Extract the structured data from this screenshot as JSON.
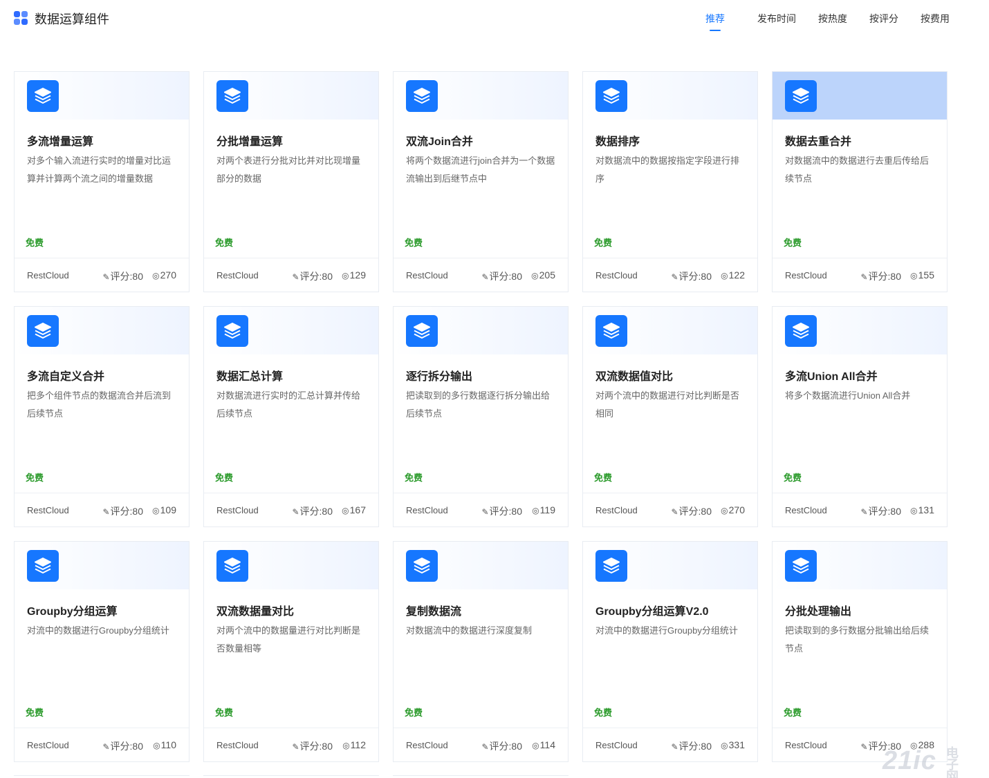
{
  "header": {
    "title": "数据运算组件",
    "tabs": [
      {
        "label": "推荐",
        "active": true
      },
      {
        "label": "发布时间",
        "active": false
      },
      {
        "label": "按热度",
        "active": false
      },
      {
        "label": "按评分",
        "active": false
      },
      {
        "label": "按费用",
        "active": false
      }
    ]
  },
  "colors": {
    "accent": "#1677ff",
    "free": "#2a9a2a"
  },
  "cards": [
    {
      "title": "多流增量运算",
      "desc": "对多个输入流进行实时的增量对比运算并计算两个流之间的增量数据",
      "price": "免费",
      "vendor": "RestCloud",
      "rating": "评分:80",
      "views": "270",
      "icon": "layers-icon",
      "highlighted": false
    },
    {
      "title": "分批增量运算",
      "desc": "对两个表进行分批对比并对比现增量部分的数据",
      "price": "免费",
      "vendor": "RestCloud",
      "rating": "评分:80",
      "views": "129",
      "icon": "layers-icon",
      "highlighted": false
    },
    {
      "title": "双流Join合并",
      "desc": "将两个数据流进行join合并为一个数据流输出到后继节点中",
      "price": "免费",
      "vendor": "RestCloud",
      "rating": "评分:80",
      "views": "205",
      "icon": "layers-icon",
      "highlighted": false
    },
    {
      "title": "数据排序",
      "desc": "对数据流中的数据按指定字段进行排序",
      "price": "免费",
      "vendor": "RestCloud",
      "rating": "评分:80",
      "views": "122",
      "icon": "layers-icon",
      "highlighted": false
    },
    {
      "title": "数据去重合并",
      "desc": "对数据流中的数据进行去重后传给后续节点",
      "price": "免费",
      "vendor": "RestCloud",
      "rating": "评分:80",
      "views": "155",
      "icon": "layers-icon",
      "highlighted": true
    },
    {
      "title": "多流自定义合并",
      "desc": "把多个组件节点的数据流合并后流到后续节点",
      "price": "免费",
      "vendor": "RestCloud",
      "rating": "评分:80",
      "views": "109",
      "icon": "layers-icon",
      "highlighted": false
    },
    {
      "title": "数据汇总计算",
      "desc": "对数据流进行实时的汇总计算并传给后续节点",
      "price": "免费",
      "vendor": "RestCloud",
      "rating": "评分:80",
      "views": "167",
      "icon": "layers-icon",
      "highlighted": false
    },
    {
      "title": "逐行拆分输出",
      "desc": "把读取到的多行数据逐行拆分输出给后续节点",
      "price": "免费",
      "vendor": "RestCloud",
      "rating": "评分:80",
      "views": "119",
      "icon": "layers-icon",
      "highlighted": false
    },
    {
      "title": "双流数据值对比",
      "desc": "对两个流中的数据进行对比判断是否相同",
      "price": "免费",
      "vendor": "RestCloud",
      "rating": "评分:80",
      "views": "270",
      "icon": "layers-icon",
      "highlighted": false
    },
    {
      "title": "多流Union All合并",
      "desc": "将多个数据流进行Union All合并",
      "price": "免费",
      "vendor": "RestCloud",
      "rating": "评分:80",
      "views": "131",
      "icon": "layers-icon",
      "highlighted": false
    },
    {
      "title": "Groupby分组运算",
      "desc": "对流中的数据进行Groupby分组统计",
      "price": "免费",
      "vendor": "RestCloud",
      "rating": "评分:80",
      "views": "110",
      "icon": "layers-icon",
      "highlighted": false
    },
    {
      "title": "双流数据量对比",
      "desc": "对两个流中的数据量进行对比判断是否数量相等",
      "price": "免费",
      "vendor": "RestCloud",
      "rating": "评分:80",
      "views": "112",
      "icon": "layers-icon",
      "highlighted": false
    },
    {
      "title": "复制数据流",
      "desc": "对数据流中的数据进行深度复制",
      "price": "免费",
      "vendor": "RestCloud",
      "rating": "评分:80",
      "views": "114",
      "icon": "layers-icon",
      "highlighted": false
    },
    {
      "title": "Groupby分组运算V2.0",
      "desc": "对流中的数据进行Groupby分组统计",
      "price": "免费",
      "vendor": "RestCloud",
      "rating": "评分:80",
      "views": "331",
      "icon": "layers-icon",
      "highlighted": false
    },
    {
      "title": "分批处理输出",
      "desc": "把读取到的多行数据分批输出给后续节点",
      "price": "免费",
      "vendor": "RestCloud",
      "rating": "评分:80",
      "views": "288",
      "icon": "layers-icon",
      "highlighted": false
    }
  ],
  "watermark": {
    "text": "21ic",
    "sub": "电子网"
  }
}
